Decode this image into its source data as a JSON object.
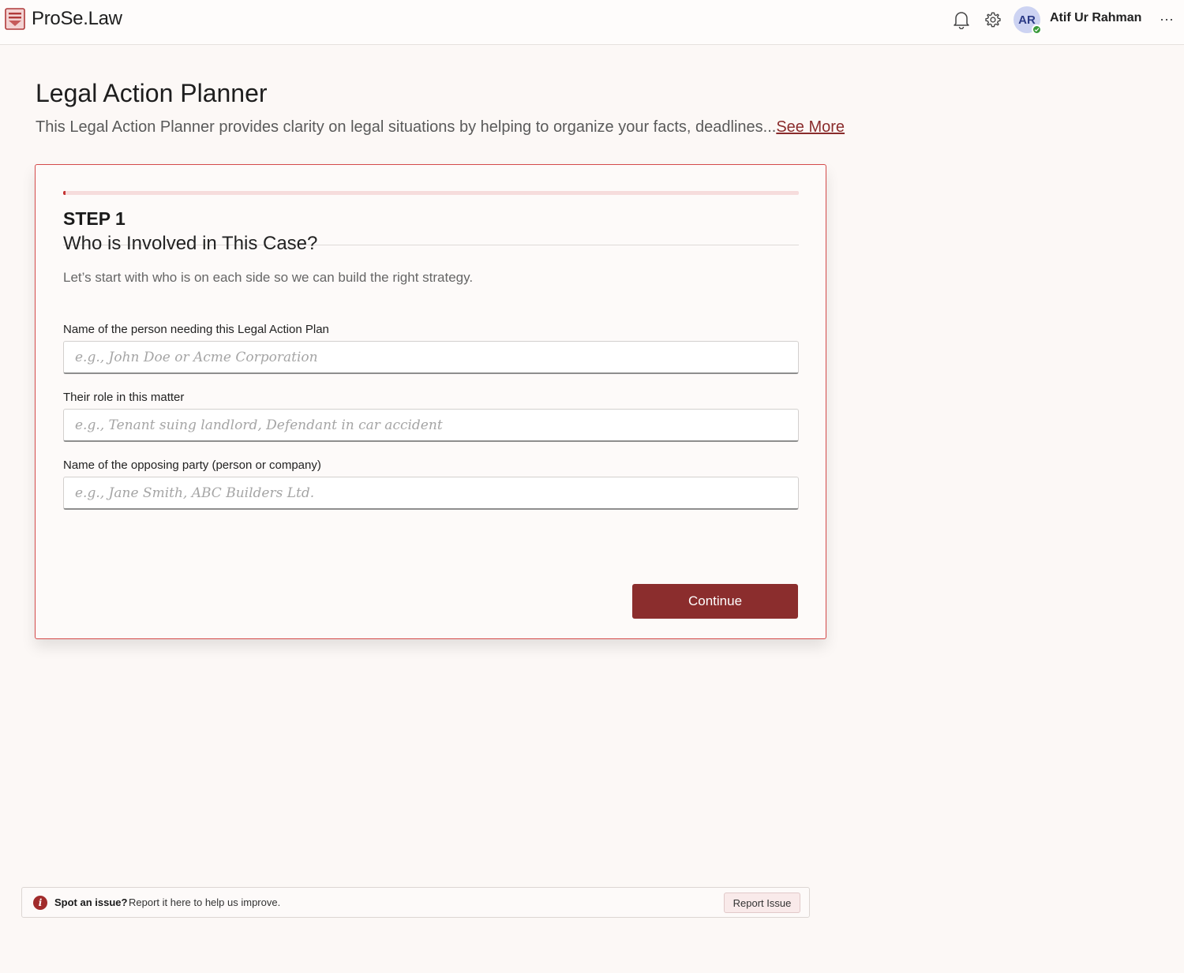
{
  "header": {
    "brand": "ProSe.Law",
    "logo_icon": "scales-document-logo",
    "notification_icon": "bell-icon",
    "settings_icon": "gear-icon",
    "user": {
      "initials": "AR",
      "name": "Atif Ur Rahman",
      "status": "online"
    },
    "more_label": "···"
  },
  "page": {
    "title": "Legal Action Planner",
    "description": "This Legal Action Planner provides clarity on legal situations by helping to organize your facts, deadlines...",
    "see_more": "See More"
  },
  "wizard": {
    "progress_percent": 0.3,
    "step_label": "STEP 1",
    "step_title": "Who is Involved in This Case?",
    "step_subtitle": "Let’s start with who is on each side so we can build the right strategy.",
    "fields": [
      {
        "label": "Name of the person needing this Legal Action Plan",
        "placeholder": "e.g., John Doe or Acme Corporation",
        "value": ""
      },
      {
        "label": "Their role in this matter",
        "placeholder": "e.g., Tenant suing landlord, Defendant in car accident",
        "value": ""
      },
      {
        "label": "Name of the opposing party (person or company)",
        "placeholder": "e.g., Jane Smith, ABC Builders Ltd.",
        "value": ""
      }
    ],
    "continue_label": "Continue"
  },
  "report": {
    "icon": "info-icon",
    "icon_glyph": "i",
    "strong": "Spot an issue?",
    "text": "Report it here to help us improve.",
    "button_label": "Report Issue"
  },
  "colors": {
    "brand": "#8b2d2d",
    "accent_border": "#d44a4a",
    "online": "#3a9a3a",
    "background": "#fcf8f6"
  }
}
